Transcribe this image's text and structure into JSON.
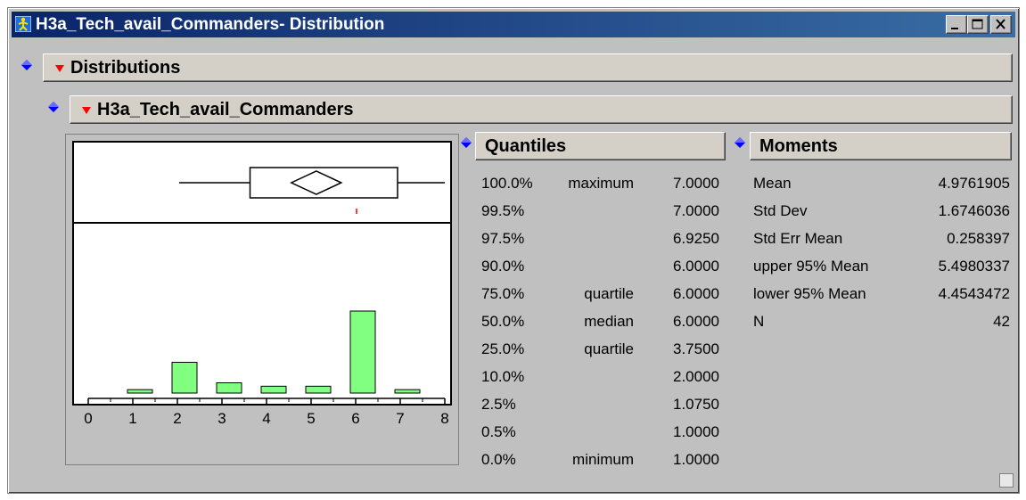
{
  "window": {
    "title": "H3a_Tech_avail_Commanders- Distribution"
  },
  "distributions": {
    "label": "Distributions"
  },
  "variable": {
    "label": "H3a_Tech_avail_Commanders"
  },
  "chart_data": {
    "type": "bar",
    "title": "",
    "xlabel": "",
    "ylabel": "",
    "xlim": [
      0,
      8
    ],
    "x_ticks": [
      "0",
      "1",
      "2",
      "3",
      "4",
      "5",
      "6",
      "7",
      "8"
    ],
    "bins": [
      {
        "from": 1,
        "to": 1.5,
        "value": 1
      },
      {
        "from": 2,
        "to": 2.5,
        "value": 9
      },
      {
        "from": 3,
        "to": 3.5,
        "value": 3
      },
      {
        "from": 4,
        "to": 4.5,
        "value": 2
      },
      {
        "from": 5,
        "to": 5.5,
        "value": 2
      },
      {
        "from": 6,
        "to": 6.5,
        "value": 24
      },
      {
        "from": 7,
        "to": 7.5,
        "value": 1
      }
    ],
    "ylim": [
      0,
      24
    ],
    "bar_color": "#80ff80",
    "boxplot": {
      "whisker_low": 1.0,
      "q1": 3.75,
      "median": 6.0,
      "q3": 6.0,
      "whisker_high": 7.0,
      "mean": 4.9761905,
      "ci_low": 4.4543472,
      "ci_high": 5.4980337
    },
    "grid": false
  },
  "quantiles": {
    "label": "Quantiles",
    "rows": [
      {
        "pct": "100.0%",
        "name": "maximum",
        "value": "7.0000"
      },
      {
        "pct": "99.5%",
        "name": "",
        "value": "7.0000"
      },
      {
        "pct": "97.5%",
        "name": "",
        "value": "6.9250"
      },
      {
        "pct": "90.0%",
        "name": "",
        "value": "6.0000"
      },
      {
        "pct": "75.0%",
        "name": "quartile",
        "value": "6.0000"
      },
      {
        "pct": "50.0%",
        "name": "median",
        "value": "6.0000"
      },
      {
        "pct": "25.0%",
        "name": "quartile",
        "value": "3.7500"
      },
      {
        "pct": "10.0%",
        "name": "",
        "value": "2.0000"
      },
      {
        "pct": "2.5%",
        "name": "",
        "value": "1.0750"
      },
      {
        "pct": "0.5%",
        "name": "",
        "value": "1.0000"
      },
      {
        "pct": "0.0%",
        "name": "minimum",
        "value": "1.0000"
      }
    ]
  },
  "moments": {
    "label": "Moments",
    "rows": [
      {
        "name": "Mean",
        "value": "4.9761905"
      },
      {
        "name": "Std Dev",
        "value": "1.6746036"
      },
      {
        "name": "Std Err Mean",
        "value": "0.258397"
      },
      {
        "name": "upper 95% Mean",
        "value": "5.4980337"
      },
      {
        "name": "lower 95% Mean",
        "value": "4.4543472"
      },
      {
        "name": "N",
        "value": "42"
      }
    ]
  },
  "icons": {
    "app": "jmp-app-icon",
    "outline": "blue-diamond-icon",
    "disclosure": "red-triangle-icon"
  },
  "colors": {
    "titlebar_start": "#0a246a",
    "titlebar_end": "#3a6ea5",
    "diamond_blue": "#0000ff",
    "triangle_red": "#ff0000",
    "bar_green": "#80ff80"
  }
}
